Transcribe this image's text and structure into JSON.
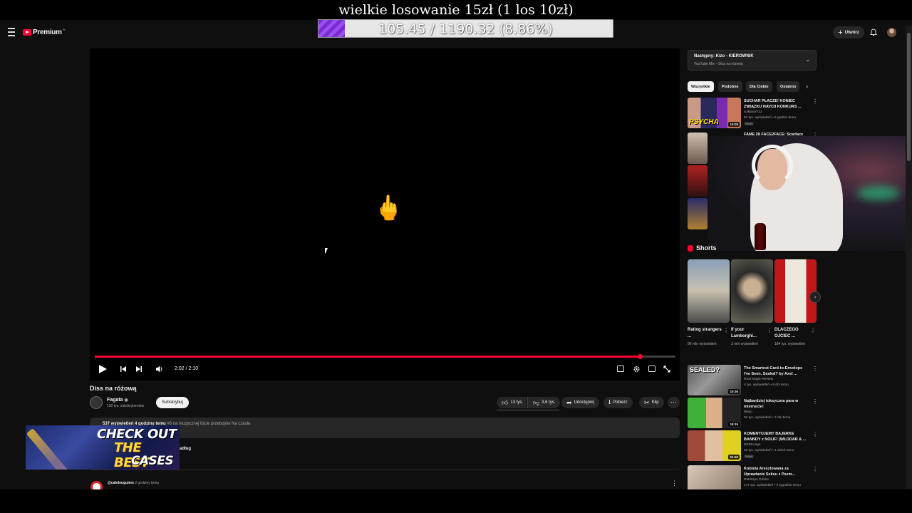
{
  "overlay": {
    "title": "wielkie losowanie 15zł (1 los 10zł)",
    "goal_text": "105.45 / 1190.32 (8.86%)",
    "goal_fraction": 0.0886,
    "goal_color": "#7a2bd1"
  },
  "masthead": {
    "menu_icon": "hamburger-icon",
    "logo_text": "Premium",
    "logo_region": "PL",
    "create_label": "Utwórz",
    "bell_icon": "bell-icon"
  },
  "player": {
    "emoji": "🖕",
    "time_display": "2:02 / 2:10",
    "progress_fraction": 0.9385,
    "accent": "#ff0033"
  },
  "video": {
    "title": "Diss na różową",
    "channel_name": "Fagata",
    "verified": "◉",
    "channel_subs": "150 tys. subskrybentów",
    "subscribe_label": "Subskrybuj",
    "likes": "13 tys.",
    "dislikes": "3,6 tys.",
    "share": "Udostępnij",
    "download": "Pobierz",
    "clip": "Klip",
    "more": "···"
  },
  "description": {
    "stats": "537 wyświetleń  4 godziny temu",
    "tag": "#6 na muzycznej liście przebojów Na czasie",
    "more_fragment": "adług"
  },
  "comment": {
    "user": "@caleteuguiem",
    "time": "2 godziny temu"
  },
  "ad": {
    "line1": "CHECK OUT",
    "line2": "THE BEST",
    "line3": "CASES"
  },
  "sidebar": {
    "next_title": "Następny: Kizo - KIEROWNIK",
    "next_sub": "YouTube Mix – Diss na różową",
    "chips": [
      "Wszystkie",
      "Podobne",
      "Dla Ciebie",
      "Ostatnio"
    ],
    "recs_top": [
      {
        "title": "SUCHAR PŁACZE! KONIEC ZWIĄZKU NAVCII KONKURS ...",
        "channel": "SzklanaY2J",
        "meta": "54 tys. wyświetleń • 6 godzin temu",
        "badge": "Nowy",
        "duration": "13:09"
      },
      {
        "title": "FAME 28 FACE2FACE: Scarface",
        "channel": "",
        "meta": "",
        "badge": "",
        "duration": ""
      }
    ],
    "shorts_header": "Shorts",
    "shorts": [
      {
        "title": "Rating strangers ...",
        "views": "96 mln wyświetleń"
      },
      {
        "title": "If your Lamborghi...",
        "views": "3 mln wyświetleń"
      },
      {
        "title": "DLACZEGO OJCIEC ...",
        "views": "184 tys. wyświetleń"
      }
    ],
    "recs_bottom": [
      {
        "title": "The Smartest Card-to-Envelope I've Seen. Sealed? by Axel ...",
        "channel": "Real Magic Review",
        "meta": "4 tys. wyświetleń • 8 dni temu",
        "badge": "",
        "duration": "15:36"
      },
      {
        "title": "Najbardziej toksyczna para w internecie!",
        "channel": "Mayo",
        "meta": "94 tys. wyświetleń • 7 dni temu",
        "badge": "",
        "duration": "18:15"
      },
      {
        "title": "KOMENTUJEMY BAJERKE BANNDY z NOLIF! (WŁODAR & ...",
        "channel": "NEEKcago",
        "meta": "53 tys. wyświetleń • 1 dzień temu",
        "badge": "Nowy",
        "duration": "51:56"
      },
      {
        "title": "Kobieta Aresztowana za Uprawianie Seksu z Psem...",
        "channel": "Detektyw Online",
        "meta": "177 tys. wyświetleń • 2 tygodnie temu",
        "badge": "",
        "duration": ""
      }
    ]
  }
}
